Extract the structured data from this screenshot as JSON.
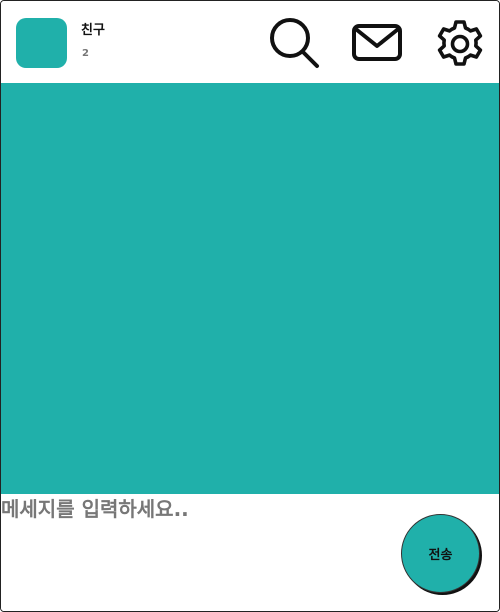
{
  "header": {
    "friend_name": "친구",
    "friend_count": "2",
    "icons": {
      "search": "search-icon",
      "mail": "mail-icon",
      "settings": "gear-icon"
    }
  },
  "composer": {
    "placeholder": "메세지를 입력하세요..",
    "send_label": "전송"
  },
  "colors": {
    "accent": "#20b0aa",
    "icon_stroke": "#111111",
    "placeholder_text": "#777777"
  }
}
